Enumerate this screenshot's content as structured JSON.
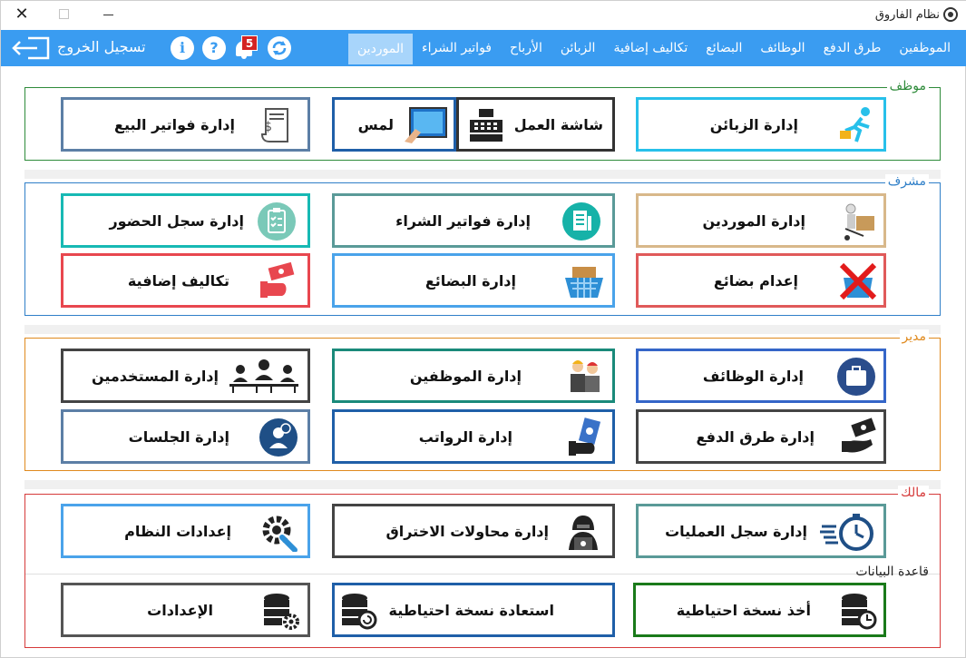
{
  "window": {
    "title": "نظام الفاروق"
  },
  "menu": {
    "items": [
      {
        "label": "الموظفين",
        "active": false
      },
      {
        "label": "طرق الدفع",
        "active": false
      },
      {
        "label": "الوظائف",
        "active": false
      },
      {
        "label": "البضائع",
        "active": false
      },
      {
        "label": "تكاليف إضافية",
        "active": false
      },
      {
        "label": "الزبائن",
        "active": false
      },
      {
        "label": "الأرباح",
        "active": false
      },
      {
        "label": "فواتير الشراء",
        "active": false
      },
      {
        "label": "الموردين",
        "active": true
      }
    ],
    "notifications_count": "5",
    "logout_label": "تسجيل الخروج",
    "info_icon": "info-icon",
    "help_icon": "help-icon",
    "refresh_icon": "refresh-icon",
    "bell_icon": "bell-icon"
  },
  "groups": {
    "employee": {
      "label": "موظف",
      "color": "#2e8b3a",
      "tiles": [
        {
          "label": "إدارة الزبائن",
          "border": "#27c0ea",
          "icon": "running-customer-icon"
        },
        {
          "label": "شاشة العمل",
          "border": "#333333",
          "icon": "cash-register-icon"
        },
        {
          "label": "لمس",
          "border": "#1f5fa8",
          "icon": "touch-screen-icon"
        },
        {
          "label": "إدارة فواتير البيع",
          "border": "#5c7fa6",
          "icon": "receipt-icon"
        }
      ]
    },
    "supervisor": {
      "label": "مشرف",
      "color": "#2f7fc8",
      "tiles": [
        {
          "label": "إدارة الموردين",
          "border": "#d8b88a",
          "icon": "delivery-person-icon"
        },
        {
          "label": "إدارة فواتير الشراء",
          "border": "#5a9a98",
          "icon": "purchase-invoice-icon"
        },
        {
          "label": "إدارة سجل الحضور",
          "border": "#17b9b4",
          "icon": "attendance-clipboard-icon"
        },
        {
          "label": "إعدام بضائع",
          "border": "#e05a5a",
          "icon": "destroy-goods-icon"
        },
        {
          "label": "إدارة البضائع",
          "border": "#4aa3ea",
          "icon": "goods-basket-icon"
        },
        {
          "label": "تكاليف إضافية",
          "border": "#e8474f",
          "icon": "money-hand-icon"
        }
      ]
    },
    "manager": {
      "label": "مدير",
      "color": "#e08a1e",
      "tiles": [
        {
          "label": "إدارة الوظائف",
          "border": "#3566c8",
          "icon": "briefcase-icon"
        },
        {
          "label": "إدارة الموظفين",
          "border": "#1a8a7a",
          "icon": "employees-icon"
        },
        {
          "label": "إدارة المستخدمين",
          "border": "#444444",
          "icon": "users-icon"
        },
        {
          "label": "إدارة طرق الدفع",
          "border": "#444444",
          "icon": "payment-methods-icon"
        },
        {
          "label": "إدارة الرواتب",
          "border": "#1f5fa8",
          "icon": "salaries-icon"
        },
        {
          "label": "إدارة الجلسات",
          "border": "#5c7fa6",
          "icon": "sessions-icon"
        }
      ]
    },
    "owner": {
      "label": "مالك",
      "color": "#d63a3a",
      "tiles": [
        {
          "label": "إدارة سجل العمليات",
          "border": "#5a9a98",
          "icon": "stopwatch-icon"
        },
        {
          "label": "إدارة محاولات الاختراق",
          "border": "#444444",
          "icon": "hacker-icon"
        },
        {
          "label": "إعدادات النظام",
          "border": "#4aa3ea",
          "icon": "system-settings-icon"
        }
      ],
      "database": {
        "label": "قاعدة البيانات",
        "tiles": [
          {
            "label": "أخذ نسخة احتياطية",
            "border": "#1a7a1a",
            "icon": "database-backup-icon"
          },
          {
            "label": "استعادة نسخة احتياطية",
            "border": "#1f5fa8",
            "icon": "database-restore-icon"
          },
          {
            "label": "الإعدادات",
            "border": "#555555",
            "icon": "database-settings-icon"
          }
        ]
      }
    }
  }
}
